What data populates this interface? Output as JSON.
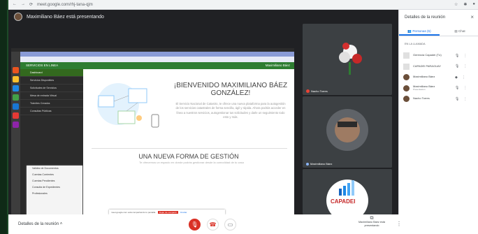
{
  "browser": {
    "url": "meet.google.com/rhj-tana-qjm"
  },
  "stage": {
    "presenter_banner": "Maximiliano Báez está presentando"
  },
  "shared_screen": {
    "tabs_label": "Actividades",
    "app_header": "SERVICIOS EN LINEA",
    "user_label": "Maximiliano Báez",
    "menu": [
      "Dashboard",
      "Servicios Disponibles",
      "Solicitudes de Servicios",
      "Mesa de entrada Virtual",
      "Trámites Creados",
      "Consultas Públicas"
    ],
    "submenu": [
      "Validez de Documentos",
      "Cuentas Corrientes",
      "Cuentas Pendientes",
      "Consulta de Expedientes",
      "Profesionales"
    ],
    "welcome_title": "¡BIENVENIDO MAXIMILIANO BÁEZ GONZÁLEZ!",
    "welcome_text": "El Servicio Nacional de Catastro, te ofrece una nueva plataforma para la autogestión de los servicios catastrales de forma sencilla, ágil y rápida. Ahora podrás acceder en línea a nuestros servicios, autogestionar tus solicitudes y darle un seguimiento todo esto y más.",
    "section_title": "UNA NUEVA FORMA DE GESTIÓN",
    "section_text": "Te ofrecemos un espacio en donde podrás gestionar desde la comodidad de tu casa",
    "share_banner": {
      "text": "meet.google.com está compartiendo tu pantalla.",
      "stop_label": "Dejar de compartir",
      "hide_label": "Ocultar"
    }
  },
  "tiles": [
    {
      "name": "Nacho Torres"
    },
    {
      "name": "Maximiliano Báez"
    },
    {
      "name": "CAPADEI"
    }
  ],
  "bottom_bar": {
    "details_label": "Detalles de la reunión",
    "presenting_label": "Maximiliano Báez está presentando"
  },
  "panel": {
    "title": "Detalles de la reunión",
    "tab_people": "Personas (5)",
    "tab_chat": "Chat",
    "in_call_label": "EN LA LLAMADA",
    "people": [
      {
        "name": "Gerencia Capadei (Tú)",
        "sub": "",
        "icon": "logo"
      },
      {
        "name": "CAPADEI PARAGUAY",
        "sub": "",
        "icon": "logo"
      },
      {
        "name": "Maximiliano Báez",
        "sub": "",
        "icon": "avatar"
      },
      {
        "name": "Maximiliano Báez",
        "sub": "Presentación",
        "icon": "avatar"
      },
      {
        "name": "Nacho Torres",
        "sub": "",
        "icon": "avatar"
      }
    ]
  },
  "colors": {
    "accent": "#1a73e8",
    "danger": "#d93025",
    "app_green": "#2e7d32",
    "meet_dark": "#202124"
  }
}
